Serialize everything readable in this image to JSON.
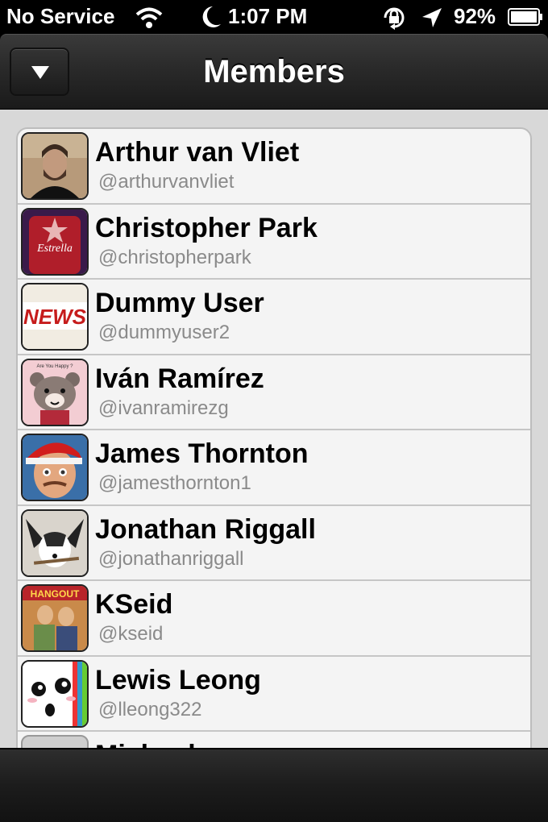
{
  "status_bar": {
    "carrier": "No Service",
    "time": "1:07 PM",
    "battery": "92%",
    "icons": [
      "wifi-icon",
      "moon-icon",
      "rotation-lock-icon",
      "location-icon",
      "battery-icon"
    ]
  },
  "nav": {
    "title": "Members",
    "menu_icon": "triangle-down-icon"
  },
  "members": [
    {
      "name": "Arthur van Vliet",
      "handle": "@arthurvanvliet"
    },
    {
      "name": "Christopher Park",
      "handle": "@christopherpark"
    },
    {
      "name": "Dummy User",
      "handle": "@dummyuser2"
    },
    {
      "name": "Iván Ramírez",
      "handle": "@ivanramirezg"
    },
    {
      "name": "James Thornton",
      "handle": "@jamesthornton1"
    },
    {
      "name": "Jonathan Riggall",
      "handle": "@jonathanriggall"
    },
    {
      "name": "KSeid",
      "handle": "@kseid"
    },
    {
      "name": "Lewis Leong",
      "handle": "@lleong322"
    },
    {
      "name": "Michael",
      "handle": ""
    }
  ],
  "avatar_text": {
    "estrella": "Estrella",
    "news": "NEWS",
    "bear": "Are You Happy ?",
    "hangout": "HANGOUT"
  }
}
